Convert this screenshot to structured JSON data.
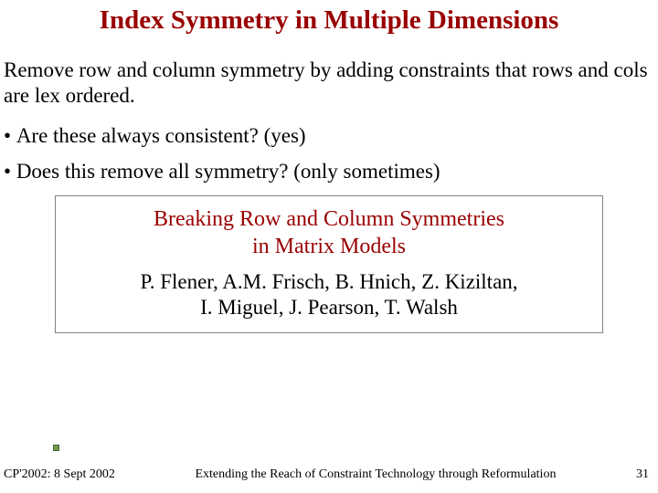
{
  "title": "Index Symmetry in Multiple Dimensions",
  "intro": "Remove row and column symmetry by adding constraints that rows and cols are lex ordered.",
  "bullets": [
    "Are these always consistent? (yes)",
    "Does this remove all symmetry? (only sometimes)"
  ],
  "reference": {
    "title_line1": "Breaking Row and Column Symmetries",
    "title_line2": "in Matrix Models",
    "authors_line1": "P. Flener, A.M. Frisch, B. Hnich, Z. Kiziltan,",
    "authors_line2": "I. Miguel, J. Pearson, T. Walsh"
  },
  "footer": {
    "left": "CP'2002: 8 Sept 2002",
    "center": "Extending the Reach of Constraint Technology through Reformulation",
    "page": "31"
  }
}
